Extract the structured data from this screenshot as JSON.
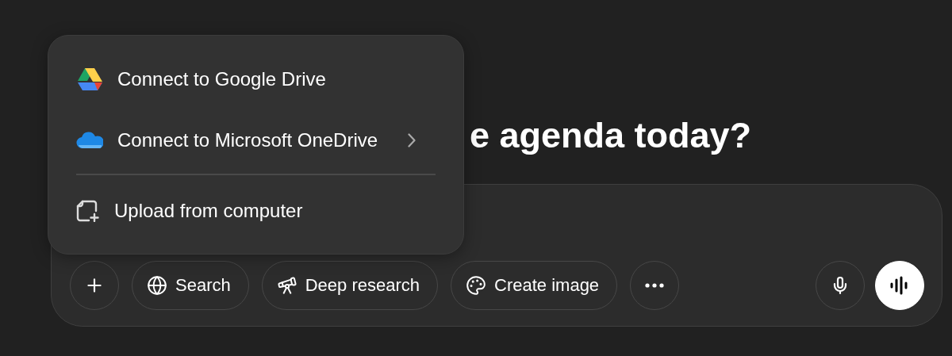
{
  "heading": "e agenda today?",
  "menu": {
    "items": [
      {
        "kind": "google_drive",
        "label": "Connect to Google Drive",
        "submenu": false
      },
      {
        "kind": "onedrive",
        "label": "Connect to Microsoft OneDrive",
        "submenu": true
      },
      {
        "kind": "divider"
      },
      {
        "kind": "upload",
        "label": "Upload from computer",
        "submenu": false
      }
    ]
  },
  "toolbar": {
    "left": [
      {
        "kind": "plus"
      },
      {
        "kind": "search",
        "label": "Search"
      },
      {
        "kind": "deep_research",
        "label": "Deep research"
      },
      {
        "kind": "create_image",
        "label": "Create image"
      },
      {
        "kind": "more"
      }
    ],
    "right": [
      {
        "kind": "mic"
      },
      {
        "kind": "voice"
      }
    ]
  }
}
